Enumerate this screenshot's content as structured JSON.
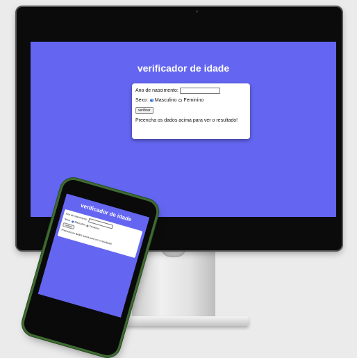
{
  "app": {
    "title": "verificador de idade",
    "form": {
      "birth_year_label": "Ano de nascimento:",
      "birth_year_value": "",
      "sex_label": "Sexo:",
      "option_male": "Masculino",
      "option_female": "Feminino",
      "selected_option": "Masculino",
      "verify_button": "verificar",
      "result_text": "Preencha os dados acima para ver o resultado!"
    }
  },
  "colors": {
    "screen_background": "#6466f1",
    "phone_frame": "#3e6b32"
  }
}
